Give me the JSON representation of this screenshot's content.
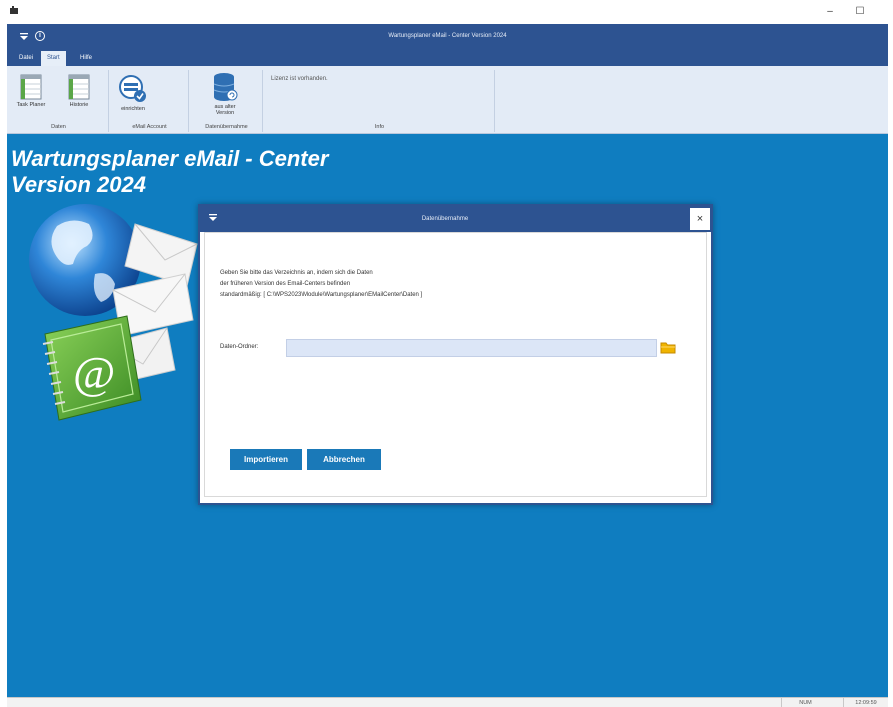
{
  "window": {
    "minimize_glyph": "–",
    "maximize_glyph": "☐"
  },
  "app": {
    "title": "Wartungsplaner eMail - Center Version 2024",
    "info_glyph": "i"
  },
  "menu": {
    "tabs": [
      {
        "label": "Datei"
      },
      {
        "label": "Start"
      },
      {
        "label": "Hilfe"
      }
    ]
  },
  "ribbon": {
    "groups": {
      "daten": {
        "label": "Daten",
        "buttons": [
          {
            "label": "Task Planer",
            "icon": "spreadsheet-icon"
          },
          {
            "label": "Historie",
            "icon": "spreadsheet-icon"
          }
        ]
      },
      "email_account": {
        "label": "eMail Account",
        "buttons": [
          {
            "label": "einrichten",
            "icon": "email-settings-icon"
          }
        ]
      },
      "datenuebernahme": {
        "label": "Datenübernahme",
        "buttons": [
          {
            "label": "aus alter Version",
            "icon": "database-import-icon"
          }
        ]
      },
      "info": {
        "label": "Info",
        "text": "Lizenz ist vorhanden."
      }
    }
  },
  "workspace": {
    "title_line1": "Wartungsplaner eMail - Center",
    "title_line2": "Version 2024",
    "at_glyph": "@"
  },
  "dialog": {
    "title": "Datenübernahme",
    "close_glyph": "×",
    "text_lines": [
      "Geben Sie bitte das Verzeichnis an, indem sich die Daten",
      "der früheren Version des Email-Centers befinden",
      "standardmäßig: [ C:\\WPS2023\\Module\\Wartungsplaner\\EMailCenter\\Daten ]"
    ],
    "folder_label": "Daten-Ordner:",
    "folder_value": "",
    "import_button": "Importieren",
    "cancel_button": "Abbrechen"
  },
  "statusbar": {
    "mode": "NUM",
    "time": "12:09:59"
  },
  "colors": {
    "header_blue": "#2d5391",
    "workspace_blue": "#0f7dc0",
    "button_blue": "#1a79b8",
    "ribbon_bg": "#e3ebf6"
  }
}
